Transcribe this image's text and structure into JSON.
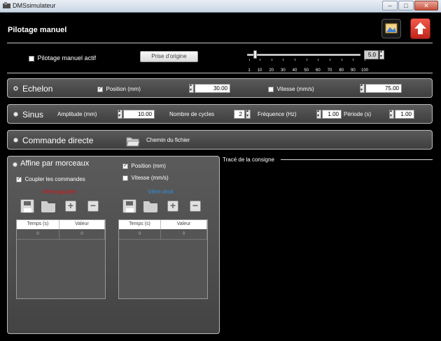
{
  "window": {
    "title": "DMSsimulateur",
    "minimize": "–",
    "maximize": "□",
    "close": "✕"
  },
  "header": {
    "title": "Pilotage manuel",
    "screenshot_icon": "image-icon",
    "upload_icon": "upload-arrow-icon"
  },
  "manual": {
    "active_label": "Pilotage manuel actif",
    "active_checked": false,
    "origin_button": "Prise d'origine",
    "speed_value": "5.0",
    "speed_fraction": 0.05,
    "ticks": [
      "1",
      "10",
      "20",
      "30",
      "40",
      "50",
      "60",
      "70",
      "80",
      "90",
      "100"
    ]
  },
  "echelon": {
    "title": "Echelon",
    "selected": true,
    "position_label": "Position (mm)",
    "position_checked": true,
    "position_value": "30.00",
    "vitesse_label": "Vitesse (mm/s)",
    "vitesse_checked": false,
    "vitesse_value": "75.00"
  },
  "sinus": {
    "title": "Sinus",
    "selected": false,
    "amplitude_label": "Amplitude (mm)",
    "amplitude_value": "10.00",
    "cycles_label": "Nombre de cycles",
    "cycles_value": "2",
    "frequence_label": "Fréquence (Hz)",
    "frequence_value": "1.00",
    "periode_label": "Période (s)",
    "periode_value": "1.00"
  },
  "commande": {
    "title": "Commande directe",
    "selected": false,
    "file_label": "Chemin du fichier"
  },
  "morceaux": {
    "title": "Affine par morceaux",
    "selected": false,
    "coupler_label": "Coupler les commandes",
    "coupler_checked": true,
    "position_label": "Position (mm)",
    "position_checked": true,
    "vitesse_label": "Vitesse (mm/s)",
    "vitesse_checked": false,
    "left": {
      "title": "Vérin gauche",
      "color": "#e01010",
      "columns": [
        "Temps (s)",
        "Valeur"
      ],
      "row": [
        "0",
        "0"
      ]
    },
    "right": {
      "title": "Vérin droit",
      "color": "#2f8fe0",
      "columns": [
        "Temps (s)",
        "Valeur"
      ],
      "row": [
        "0",
        "0"
      ]
    },
    "plus": "+",
    "minus": "−"
  },
  "graph": {
    "title": "Tracé de la consigne"
  }
}
